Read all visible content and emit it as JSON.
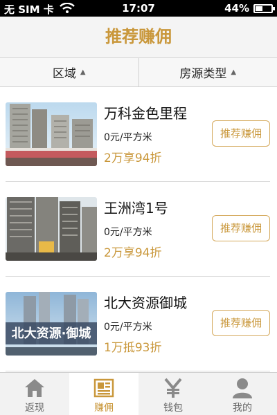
{
  "status_bar": {
    "carrier": "无 SIM 卡",
    "time": "17:07",
    "battery": "44%",
    "battery_level": 0.44
  },
  "header": {
    "title": "推荐赚佣"
  },
  "filters": [
    {
      "label": "区域"
    },
    {
      "label": "房源类型"
    }
  ],
  "listings": [
    {
      "name": "万科金色里程",
      "price": "0元/平方米",
      "deal": "2万享94折",
      "button": "推荐赚佣",
      "image": "building-photo"
    },
    {
      "name": "王洲湾1号",
      "price": "0元/平方米",
      "deal": "2万享94折",
      "button": "推荐赚佣",
      "image": "building-photo"
    },
    {
      "name": "北大资源御城",
      "price": "0元/平方米",
      "deal": "1万抵93折",
      "button": "推荐赚佣",
      "image": "building-photo",
      "image_text": "北大资源·御城"
    }
  ],
  "tabs": [
    {
      "label": "返现",
      "icon": "home-icon",
      "active": false
    },
    {
      "label": "赚佣",
      "icon": "newspaper-icon",
      "active": true
    },
    {
      "label": "钱包",
      "icon": "yen-icon",
      "active": false
    },
    {
      "label": "我的",
      "icon": "user-icon",
      "active": false
    }
  ],
  "colors": {
    "accent": "#c9973a",
    "status_bar": "#000000"
  }
}
